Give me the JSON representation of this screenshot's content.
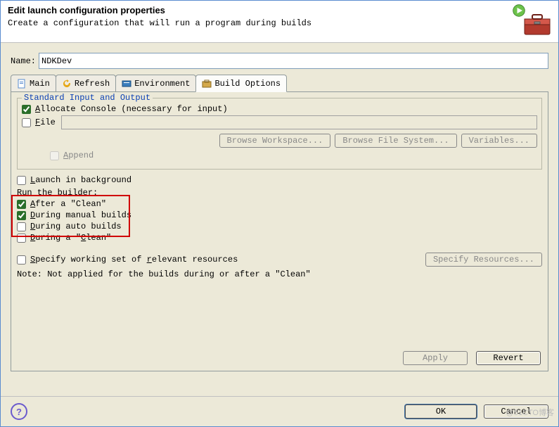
{
  "header": {
    "title": "Edit launch configuration properties",
    "subtitle": "Create a configuration that will run a program during builds"
  },
  "name": {
    "label": "Name:",
    "value": "NDKDev"
  },
  "tabs": {
    "main": "Main",
    "refresh": "Refresh",
    "environment": "Environment",
    "build_options": "Build Options"
  },
  "stdio": {
    "legend": "Standard Input and Output",
    "allocate_pre": "A",
    "allocate_rest": "llocate Console (necessary for input)",
    "file_pre": "F",
    "file_rest": "ile",
    "append_pre": "A",
    "append_rest": "ppend",
    "browse_workspace": "Browse Workspace...",
    "browse_filesystem": "Browse File System...",
    "variables": "Variables..."
  },
  "background": {
    "pre": "L",
    "rest": "aunch in background"
  },
  "runbuilder": {
    "title": "Run the builder:",
    "after_clean_pre": "A",
    "after_clean_rest": "fter a \"Clean\"",
    "manual_pre": "D",
    "manual_rest": "uring manual builds",
    "auto_pre": "D",
    "auto_rest": "uring auto builds",
    "during_clean_pre": "D",
    "during_clean_mid": "uring a \"",
    "during_clean_und": "C",
    "during_clean_end": "lean\""
  },
  "workingset": {
    "label_pre": "S",
    "label_mid": "pecify working set of ",
    "label_und": "r",
    "label_end": "elevant resources",
    "button": "Specify Resources...",
    "note": "Note: Not applied for the builds during or after a \"Clean\""
  },
  "footer": {
    "apply": "Apply",
    "revert": "Revert",
    "ok": "OK",
    "cancel": "Cancel"
  },
  "watermark": "@51CTO博客"
}
